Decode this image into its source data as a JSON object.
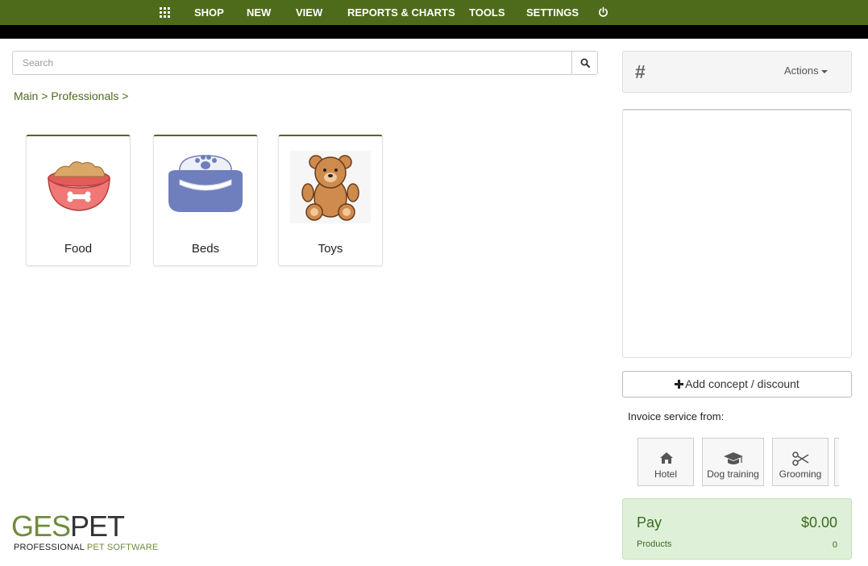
{
  "nav": {
    "items": [
      "SHOP",
      "NEW",
      "VIEW",
      "REPORTS & CHARTS",
      "TOOLS",
      "SETTINGS"
    ]
  },
  "search": {
    "placeholder": "Search"
  },
  "breadcrumb": {
    "main": "Main",
    "sep1": ">",
    "professionals": "Professionals",
    "sep2": ">"
  },
  "categories": [
    {
      "label": "Food",
      "icon": "dog-food-bowl-icon"
    },
    {
      "label": "Beds",
      "icon": "pet-bed-icon"
    },
    {
      "label": "Toys",
      "icon": "teddy-bear-icon"
    }
  ],
  "panel": {
    "hash": "#",
    "actions_label": "Actions",
    "add_button": "Add concept / discount",
    "invoice_label": "Invoice service from:"
  },
  "services": [
    {
      "label": "Hotel",
      "icon": "home-icon"
    },
    {
      "label": "Dog training",
      "icon": "graduation-cap-icon"
    },
    {
      "label": "Grooming",
      "icon": "scissors-icon"
    }
  ],
  "pay": {
    "title": "Pay",
    "amount": "$0.00",
    "products_label": "Products",
    "products_count": "0"
  },
  "logo": {
    "part1": "GES",
    "part2": "PET",
    "sub_a": "PROFESSIONAL ",
    "sub_b": "PET SOFTWARE"
  },
  "colors": {
    "brand": "#4e6b1c",
    "pay_bg": "#dff0d8"
  }
}
